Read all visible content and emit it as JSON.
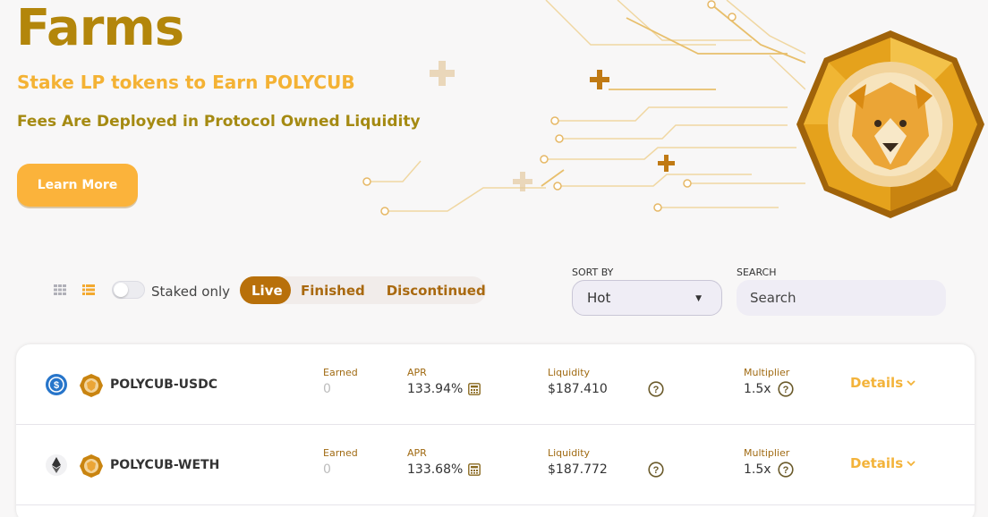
{
  "hero": {
    "title": "Farms",
    "subtitle": "Stake LP tokens to Earn POLYCUB",
    "tagline": "Fees Are Deployed in Protocol Owned Liquidity",
    "learn_more_label": "Learn More"
  },
  "controls": {
    "staked_only_label": "Staked only",
    "staked_only": false,
    "tabs": [
      {
        "label": "Live",
        "active": true
      },
      {
        "label": "Finished",
        "active": false
      },
      {
        "label": "Discontinued",
        "active": false
      }
    ],
    "sort_by_label": "SORT BY",
    "sort_by_value": "Hot",
    "search_label": "SEARCH",
    "search_placeholder": "Search"
  },
  "farms": [
    {
      "name": "POLYCUB-USDC",
      "token_a_icon": "usdc-icon",
      "token_b_icon": "polycub-icon",
      "earned_label": "Earned",
      "earned": "0",
      "apr_label": "APR",
      "apr": "133.94%",
      "liquidity_label": "Liquidity",
      "liquidity": "$187.410",
      "multiplier_label": "Multiplier",
      "multiplier": "1.5x",
      "details_label": "Details"
    },
    {
      "name": "POLYCUB-WETH",
      "token_a_icon": "eth-icon",
      "token_b_icon": "polycub-icon",
      "earned_label": "Earned",
      "earned": "0",
      "apr_label": "APR",
      "apr": "133.68%",
      "liquidity_label": "Liquidity",
      "liquidity": "$187.772",
      "multiplier_label": "Multiplier",
      "multiplier": "1.5x",
      "details_label": "Details"
    }
  ],
  "colors": {
    "brand_gold": "#b3860b",
    "accent_orange": "#fbb33b",
    "tab_active": "#b8700a"
  }
}
